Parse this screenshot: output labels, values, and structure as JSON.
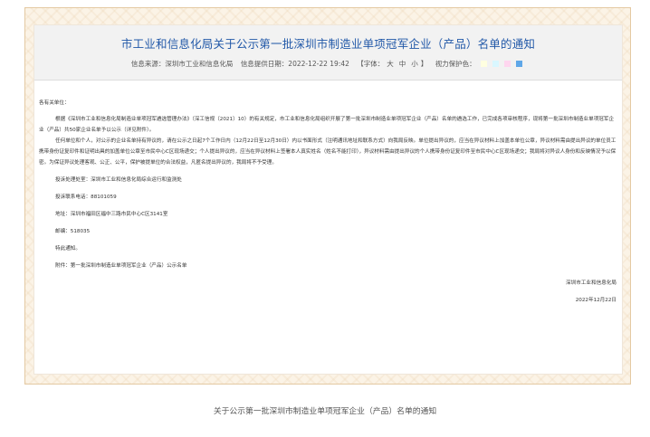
{
  "notice": {
    "title": "市工业和信息化局关于公示第一批深圳市制造业单项冠军企业（产品）名单的通知",
    "meta": {
      "source": "信息来源：深圳市工业和信息化局",
      "date": "信息提供日期：2022-12-22 19:42",
      "font_open": "【字体：",
      "font_large": "大",
      "font_medium": "中",
      "font_small": "小",
      "font_close": "】",
      "vision_label": "视力保护色：",
      "swatch_colors": [
        "#ffffe0",
        "#d9f7ff",
        "#ffd6ef",
        "#5fa7e8"
      ]
    },
    "body": {
      "greeting": "各有关单位：",
      "paragraphs": [
        "根据《深圳市工业和信息化局制造业单项冠军遴选管理办法》（深工信规〔2021〕10）的有关规定，市工业和信息化局组织开展了第一批深圳市制造业单项冠军企业（产品）名单的遴选工作，已完成各项审核程序，现将第一批深圳市制造业单项冠军企业（产品）共50家企业名单予以公示（详见附件）。",
        "任何单位和个人，对公示的企业名单持有异议的，请在公示之日起7个工作日内（12月22日至12月30日）内以书面形式（注明通讯地址和联系方式）向我局反映。单位提出异议的，应当在异议材料上加盖本单位公章，异议材料需由提出异议的单位员工携带身份证复印件和证明出具的加盖单位公章至市民中心C区现场递交；个人提出异议的，应当在异议材料上签署本人真实姓名（姓名不能打印），异议材料需由提出异议的个人携带身份证复印件至市民中心C区现场递交；我局将对异议人身份和反映情况予以保密。为保证异议处理客观、公正、公平，保护被提单位的合法权益，凡匿名提出异议的，我局将不予受理。"
      ],
      "contact": [
        "投诉处理处室：深圳市工业和信息化局综合运行和监测处",
        "投诉联系电话：88101059",
        "地址：深圳市福田区福中三路市民中心C区3141室",
        "邮编：518035",
        "特此通知。",
        "附件：第一批深圳市制造业单项冠军企业（产品）公示名单"
      ],
      "signature": "深圳市工业和信息化局",
      "sign_date": "2022年12月22日"
    }
  },
  "caption": "关于公示第一批深圳市制造业单项冠军企业（产品）名单的通知"
}
